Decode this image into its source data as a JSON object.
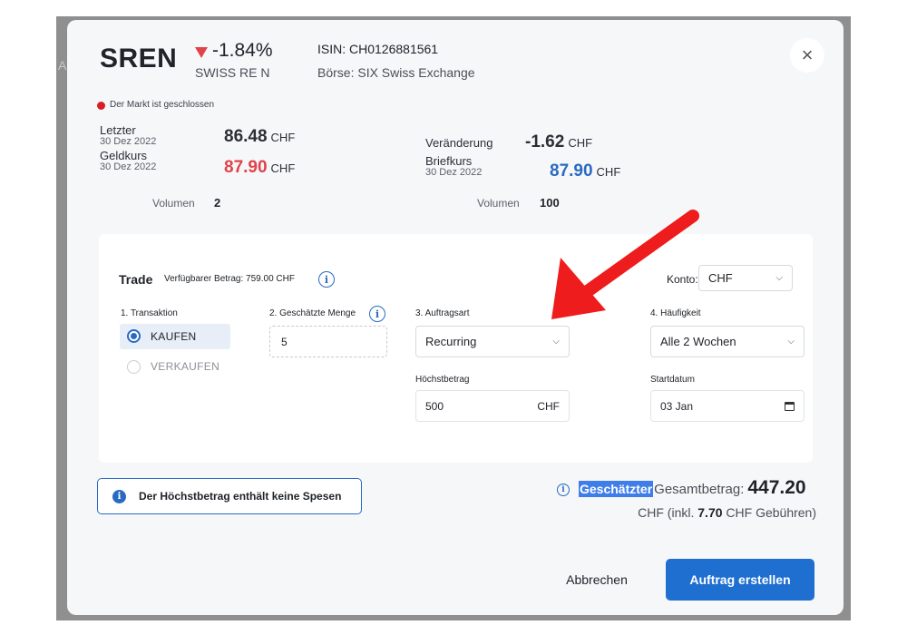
{
  "header": {
    "ticker": "SREN",
    "change_pct": "-1.84%",
    "full_name": "SWISS RE N",
    "isin": "ISIN: CH0126881561",
    "exchange": "Börse: SIX Swiss Exchange",
    "close_icon": "×"
  },
  "market_status": "Der Markt ist geschlossen",
  "quotes": {
    "last_label": "Letzter",
    "last_date": "30 Dez 2022",
    "last_value": "86.48",
    "bid_label": "Geldkurs",
    "bid_date": "30 Dez 2022",
    "bid_value": "87.90",
    "bid_volume_label": "Volumen",
    "bid_volume": "2",
    "change_label": "Veränderung",
    "change_value": "-1.62",
    "ask_label": "Briefkurs",
    "ask_date": "30 Dez 2022",
    "ask_value": "87.90",
    "ask_volume_label": "Volumen",
    "ask_volume": "100",
    "currency": "CHF"
  },
  "trade": {
    "title": "Trade",
    "available": "Verfügbarer Betrag: 759.00 CHF",
    "konto_label": "Konto:",
    "konto_value": "CHF",
    "transaction_label": "1. Transaktion",
    "buy_label": "KAUFEN",
    "sell_label": "VERKAUFEN",
    "quantity_label": "2. Geschätzte Menge",
    "quantity_value": "5",
    "order_type_label": "3. Auftragsart",
    "order_type_value": "Recurring",
    "frequency_label": "4. Häufigkeit",
    "frequency_value": "Alle 2 Wochen",
    "max_amount_label": "Höchstbetrag",
    "max_amount_value": "500",
    "max_amount_currency": "CHF",
    "start_date_label": "Startdatum",
    "start_date_value": "03 Jan"
  },
  "notice": "Der Höchstbetrag enthält keine Spesen",
  "total": {
    "highlight": "Geschätzter",
    "label": "Gesamtbetrag:",
    "value": "447.20",
    "fees_prefix": "CHF (inkl.",
    "fees_value": "7.70",
    "fees_suffix": "CHF Gebühren)"
  },
  "actions": {
    "cancel": "Abbrechen",
    "submit": "Auftrag erstellen"
  },
  "icons": {
    "info": "i",
    "chevron": "⌄",
    "annotation_color": "#ee1c1c"
  }
}
